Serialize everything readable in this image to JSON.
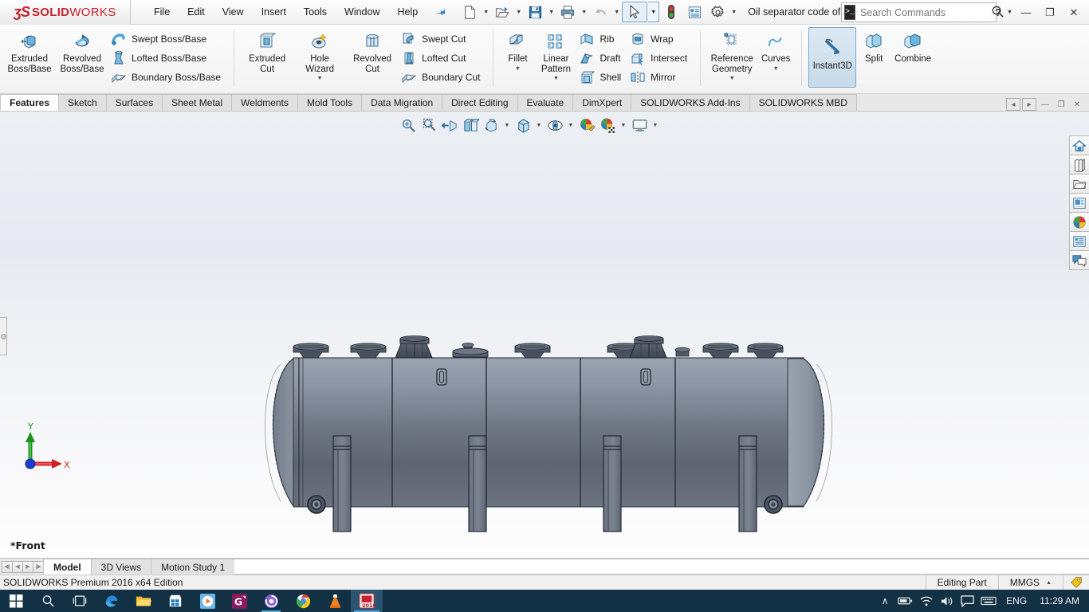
{
  "titlebar": {
    "logo_ds": "ʒS",
    "logo_main": "SOLID",
    "logo_light": "WORKS",
    "menus": [
      "File",
      "Edit",
      "View",
      "Insert",
      "Tools",
      "Window",
      "Help"
    ],
    "pin_icon": "pin-icon",
    "quick_access": [
      {
        "name": "new-document-button",
        "icon": "new-document-icon",
        "caret": true
      },
      {
        "name": "open-document-button",
        "icon": "open-folder-icon",
        "caret": true
      },
      {
        "name": "save-button",
        "icon": "save-floppy-icon",
        "caret": true
      },
      {
        "name": "print-button",
        "icon": "printer-icon",
        "caret": true
      },
      {
        "name": "undo-button",
        "icon": "undo-arrow-icon",
        "caret": true
      },
      {
        "name": "select-button",
        "icon": "cursor-arrow-icon",
        "caret": true
      },
      {
        "name": "rebuild-button",
        "icon": "traffic-light-icon",
        "caret": false
      },
      {
        "name": "options-list-button",
        "icon": "file-properties-icon",
        "caret": false
      },
      {
        "name": "options-button",
        "icon": "gear-icon",
        "caret": true
      }
    ],
    "document_title": "Oil separator code of constructio...",
    "search_placeholder": "Search Commands",
    "search_value": "",
    "search_icon": "magnifier-icon",
    "help_label": "?",
    "window_buttons": {
      "minimize": "—",
      "restore": "❐",
      "close": "✕"
    }
  },
  "ribbon": {
    "groups": [
      {
        "name": "boss-base-group",
        "big": [
          {
            "name": "extruded-boss-base-button",
            "label": "Extruded\nBoss/Base",
            "icon": "extrude-boss-icon"
          },
          {
            "name": "revolved-boss-base-button",
            "label": "Revolved\nBoss/Base",
            "icon": "revolve-boss-icon"
          }
        ],
        "small": [
          {
            "name": "swept-boss-base-button",
            "label": "Swept Boss/Base",
            "icon": "swept-boss-icon"
          },
          {
            "name": "lofted-boss-base-button",
            "label": "Lofted Boss/Base",
            "icon": "lofted-boss-icon"
          },
          {
            "name": "boundary-boss-base-button",
            "label": "Boundary Boss/Base",
            "icon": "boundary-boss-icon"
          }
        ]
      },
      {
        "name": "cut-group",
        "big": [
          {
            "name": "extruded-cut-button",
            "label": "Extruded\nCut",
            "icon": "extrude-cut-icon"
          },
          {
            "name": "hole-wizard-button",
            "label": "Hole\nWizard",
            "icon": "hole-wizard-icon",
            "dropdown": true
          },
          {
            "name": "revolved-cut-button",
            "label": "Revolved\nCut",
            "icon": "revolve-cut-icon"
          }
        ],
        "small": [
          {
            "name": "swept-cut-button",
            "label": "Swept Cut",
            "icon": "swept-cut-icon"
          },
          {
            "name": "lofted-cut-button",
            "label": "Lofted Cut",
            "icon": "lofted-cut-icon"
          },
          {
            "name": "boundary-cut-button",
            "label": "Boundary Cut",
            "icon": "boundary-cut-icon"
          }
        ]
      },
      {
        "name": "feature-group",
        "big": [
          {
            "name": "fillet-button",
            "label": "Fillet",
            "icon": "fillet-icon",
            "dropdown": true
          },
          {
            "name": "linear-pattern-button",
            "label": "Linear\nPattern",
            "icon": "linear-pattern-icon",
            "dropdown": true
          }
        ],
        "small": [
          {
            "name": "rib-button",
            "label": "Rib",
            "icon": "rib-icon"
          },
          {
            "name": "draft-button",
            "label": "Draft",
            "icon": "draft-icon"
          },
          {
            "name": "shell-button",
            "label": "Shell",
            "icon": "shell-icon"
          }
        ],
        "small2": [
          {
            "name": "wrap-button",
            "label": "Wrap",
            "icon": "wrap-icon"
          },
          {
            "name": "intersect-button",
            "label": "Intersect",
            "icon": "intersect-icon"
          },
          {
            "name": "mirror-button",
            "label": "Mirror",
            "icon": "mirror-icon"
          }
        ]
      },
      {
        "name": "geometry-group",
        "big": [
          {
            "name": "reference-geometry-button",
            "label": "Reference\nGeometry",
            "icon": "reference-plane-icon",
            "dropdown": true
          },
          {
            "name": "curves-button",
            "label": "Curves",
            "icon": "curves-icon",
            "dropdown": true
          }
        ]
      },
      {
        "name": "instant3d-group",
        "big": [
          {
            "name": "instant3d-button",
            "label": "Instant3D",
            "icon": "instant3d-icon",
            "active": true
          },
          {
            "name": "split-button",
            "label": "Split",
            "icon": "split-icon"
          },
          {
            "name": "combine-button",
            "label": "Combine",
            "icon": "combine-icon"
          }
        ]
      }
    ]
  },
  "tabs": {
    "items": [
      "Features",
      "Sketch",
      "Surfaces",
      "Sheet Metal",
      "Weldments",
      "Mold Tools",
      "Data Migration",
      "Direct Editing",
      "Evaluate",
      "DimXpert",
      "SOLIDWORKS Add-Ins",
      "SOLIDWORKS MBD"
    ],
    "active": "Features",
    "window_controls": [
      {
        "name": "doc-scroll-left-button",
        "icon": "chevron-left-boxed-icon",
        "glyph": "◂"
      },
      {
        "name": "doc-scroll-right-button",
        "icon": "chevron-right-boxed-icon",
        "glyph": "▸"
      },
      {
        "name": "doc-minimize-button",
        "icon": "minimize-icon",
        "glyph": "—"
      },
      {
        "name": "doc-restore-button",
        "icon": "restore-icon",
        "glyph": "❐"
      },
      {
        "name": "doc-close-button",
        "icon": "close-icon",
        "glyph": "✕"
      }
    ]
  },
  "graphics": {
    "view_label": "*Front",
    "heads_up": [
      {
        "name": "zoom-to-fit-button",
        "icon": "zoom-to-fit-icon",
        "caret": false
      },
      {
        "name": "zoom-to-area-button",
        "icon": "zoom-to-area-icon",
        "caret": false
      },
      {
        "name": "previous-view-button",
        "icon": "previous-view-icon",
        "caret": false
      },
      {
        "name": "section-view-button",
        "icon": "section-view-icon",
        "caret": false
      },
      {
        "name": "view-orientation-button",
        "icon": "view-orientation-icon",
        "caret": false
      },
      {
        "name": "display-style-button",
        "icon": "display-style-icon",
        "caret": true
      },
      {
        "name": "hide-show-items-button",
        "icon": "hide-show-items-icon",
        "caret": true
      },
      {
        "name": "edit-appearance-button",
        "icon": "edit-appearance-icon",
        "caret": true
      },
      {
        "name": "apply-scene-button",
        "icon": "apply-scene-icon",
        "caret": true
      },
      {
        "name": "view-settings-button",
        "icon": "view-settings-icon",
        "caret": true
      },
      {
        "name": "display-monitor-button",
        "icon": "monitor-icon",
        "caret": true
      }
    ],
    "triad": {
      "x_label": "X",
      "y_label": "Y"
    },
    "model": {
      "name": "horizontal-pressure-vessel",
      "description": "Oil separator horizontal cylindrical pressure vessel with dished heads, top nozzles, manways, saddle/leg supports and end flanges"
    }
  },
  "task_pane": [
    {
      "name": "task-pane-home-button",
      "icon": "home-icon"
    },
    {
      "name": "task-pane-design-library-button",
      "icon": "design-library-icon"
    },
    {
      "name": "task-pane-file-explorer-button",
      "icon": "folder-icon"
    },
    {
      "name": "task-pane-view-palette-button",
      "icon": "view-palette-icon"
    },
    {
      "name": "task-pane-appearances-button",
      "icon": "appearances-sphere-icon"
    },
    {
      "name": "task-pane-custom-properties-button",
      "icon": "custom-properties-icon"
    },
    {
      "name": "task-pane-forum-button",
      "icon": "forum-speech-icon"
    }
  ],
  "bottom_tabs": {
    "nav": [
      {
        "name": "first-tab-button",
        "glyph": "⏮"
      },
      {
        "name": "prev-tab-button",
        "glyph": "◀"
      },
      {
        "name": "next-tab-button",
        "glyph": "▶"
      },
      {
        "name": "last-tab-button",
        "glyph": "⏭"
      }
    ],
    "items": [
      "Model",
      "3D Views",
      "Motion Study 1"
    ],
    "active": "Model"
  },
  "statusbar": {
    "left_text": "SOLIDWORKS Premium 2016 x64 Edition",
    "editing_state": "Editing Part",
    "units": "MMGS",
    "units_caret": "▲",
    "tag_icon": "tag-icon"
  },
  "taskbar": {
    "items": [
      {
        "name": "start-button",
        "icon": "windows-logo-icon",
        "state": "normal"
      },
      {
        "name": "search-taskbar-button",
        "icon": "search-icon",
        "state": "normal"
      },
      {
        "name": "task-view-button",
        "icon": "task-view-icon",
        "state": "normal"
      },
      {
        "name": "edge-browser-button",
        "icon": "edge-icon",
        "state": "normal"
      },
      {
        "name": "file-explorer-button",
        "icon": "file-explorer-icon",
        "state": "normal"
      },
      {
        "name": "microsoft-store-button",
        "icon": "store-icon",
        "state": "normal"
      },
      {
        "name": "media-player-button",
        "icon": "play-circle-icon",
        "state": "normal"
      },
      {
        "name": "gom-player-button",
        "icon": "g-app-icon",
        "state": "normal"
      },
      {
        "name": "bittorrent-button",
        "icon": "purple-swirl-icon",
        "state": "running"
      },
      {
        "name": "chrome-button",
        "icon": "chrome-icon",
        "state": "normal"
      },
      {
        "name": "vlc-player-button",
        "icon": "vlc-cone-icon",
        "state": "normal"
      },
      {
        "name": "solidworks-taskbar-button",
        "icon": "solidworks-2016-icon",
        "state": "active"
      }
    ],
    "tray": {
      "chevron": "∧",
      "icons": [
        {
          "name": "battery-icon"
        },
        {
          "name": "wifi-icon"
        },
        {
          "name": "volume-icon"
        },
        {
          "name": "action-center-icon"
        },
        {
          "name": "keyboard-icon"
        }
      ],
      "language": "ENG",
      "clock": "11:29 AM"
    }
  },
  "colors": {
    "brand_red": "#c8202c",
    "accent_blue": "#2a7fc9",
    "taskbar_bg": "#123145",
    "ribbon_bg": "#f2f2f2",
    "model_gray": "#6b7280"
  }
}
